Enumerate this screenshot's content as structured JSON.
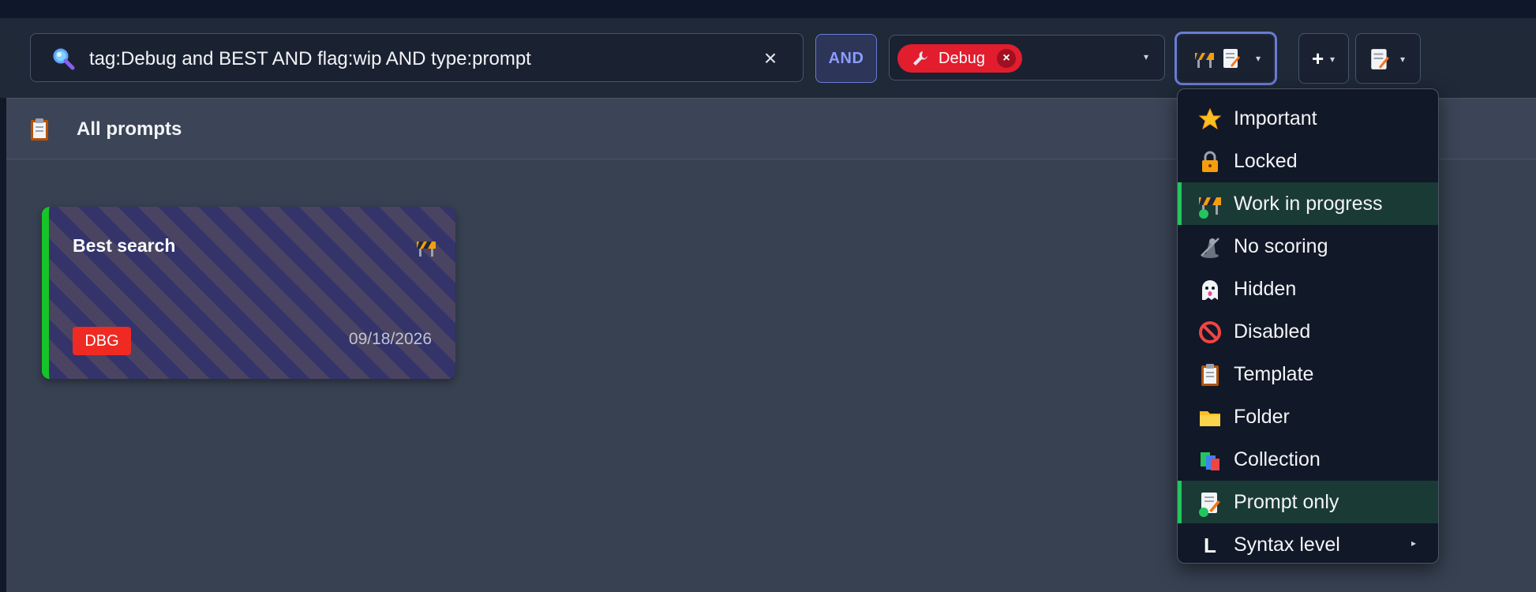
{
  "search": {
    "query": "tag:Debug and BEST AND flag:wip AND type:prompt",
    "clear_glyph": "×"
  },
  "operator": {
    "label": "AND"
  },
  "tag_filter": {
    "chip_label": "Debug",
    "chip_remove": "×",
    "caret": "▾"
  },
  "flag_filter": {
    "caret": "▾"
  },
  "add": {
    "label": "+",
    "caret": "▾"
  },
  "type_filter": {
    "caret": "▾"
  },
  "header": {
    "title": "All prompts"
  },
  "card": {
    "title": "Best search",
    "badge": "DBG",
    "date": "09/18/2026",
    "accent_color": "#16c427",
    "badge_color": "#ef2a22"
  },
  "menu": {
    "items": [
      {
        "label": "Important",
        "icon": "star-icon",
        "active": false
      },
      {
        "label": "Locked",
        "icon": "lock-icon",
        "active": false
      },
      {
        "label": "Work in progress",
        "icon": "construction-barrier-icon",
        "active": true
      },
      {
        "label": "No scoring",
        "icon": "no-scoring-icon",
        "active": false
      },
      {
        "label": "Hidden",
        "icon": "ghost-icon",
        "active": false
      },
      {
        "label": "Disabled",
        "icon": "prohibited-icon",
        "active": false
      },
      {
        "label": "Template",
        "icon": "clipboard-icon",
        "active": false
      },
      {
        "label": "Folder",
        "icon": "folder-icon",
        "active": false
      },
      {
        "label": "Collection",
        "icon": "books-icon",
        "active": false
      },
      {
        "label": "Prompt only",
        "icon": "memo-icon",
        "active": true
      },
      {
        "label": "Syntax level",
        "icon": "L",
        "active": false,
        "submenu_arrow": "▸"
      }
    ]
  },
  "colors": {
    "active_indicator": "#22c55e",
    "operator_accent": "#8b9cff",
    "tag_chip": "#e11d2e"
  }
}
